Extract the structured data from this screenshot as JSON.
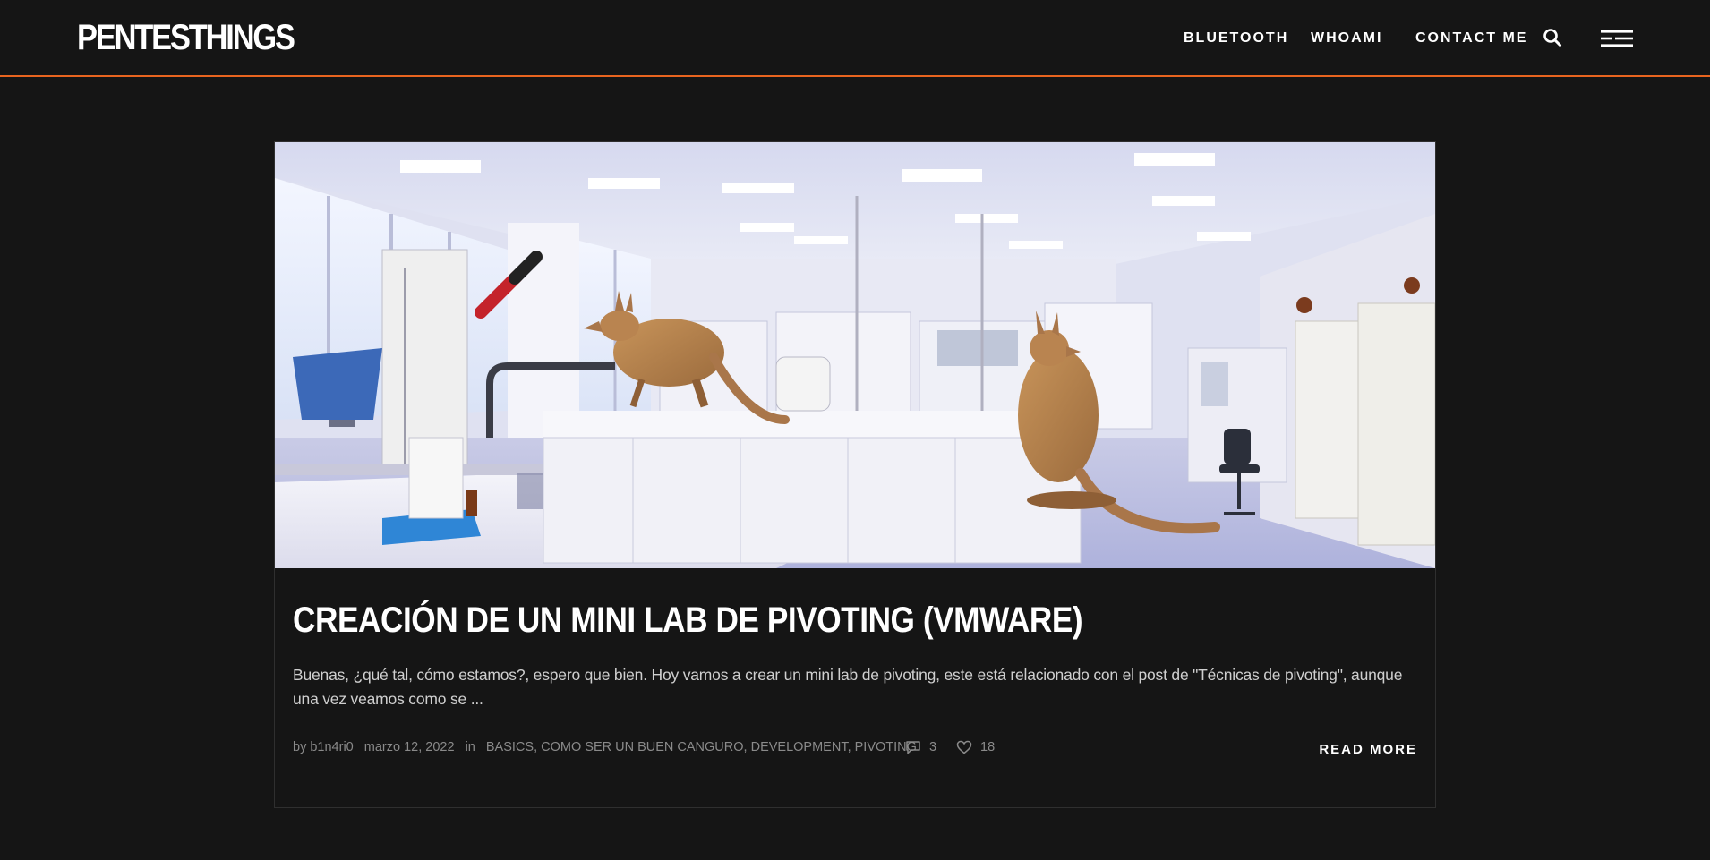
{
  "brand": {
    "logo_text": "PENTESTHINGS",
    "accent_color": "#e8641f",
    "background_color": "#151515"
  },
  "nav": {
    "items": [
      {
        "label": "BLUETOOTH"
      },
      {
        "label": "WHOAMI"
      },
      {
        "label": "CONTACT ME"
      }
    ],
    "search_icon": "search-icon",
    "menu_icon": "hamburger-menu-icon"
  },
  "post": {
    "image_alt": "Laboratorio con dos canguros",
    "title": "CREACIÓN DE UN MINI LAB DE PIVOTING (VMWARE)",
    "excerpt": "Buenas, ¿qué tal, cómo estamos?, espero que bien. Hoy vamos a crear un mini lab de pivoting, este está relacionado con el post de \"Técnicas de pivoting\", aunque una vez veamos como se ...",
    "meta": {
      "author_prefix": "by",
      "author": "b1n4ri0",
      "date": "marzo 12, 2022",
      "categories_prefix": "in",
      "categories": [
        "BASICS",
        "COMO SER UN BUEN CANGURO",
        "DEVELOPMENT",
        "PIVOTING"
      ],
      "comments_count": "3",
      "likes_count": "18"
    },
    "read_more_label": "READ MORE"
  }
}
